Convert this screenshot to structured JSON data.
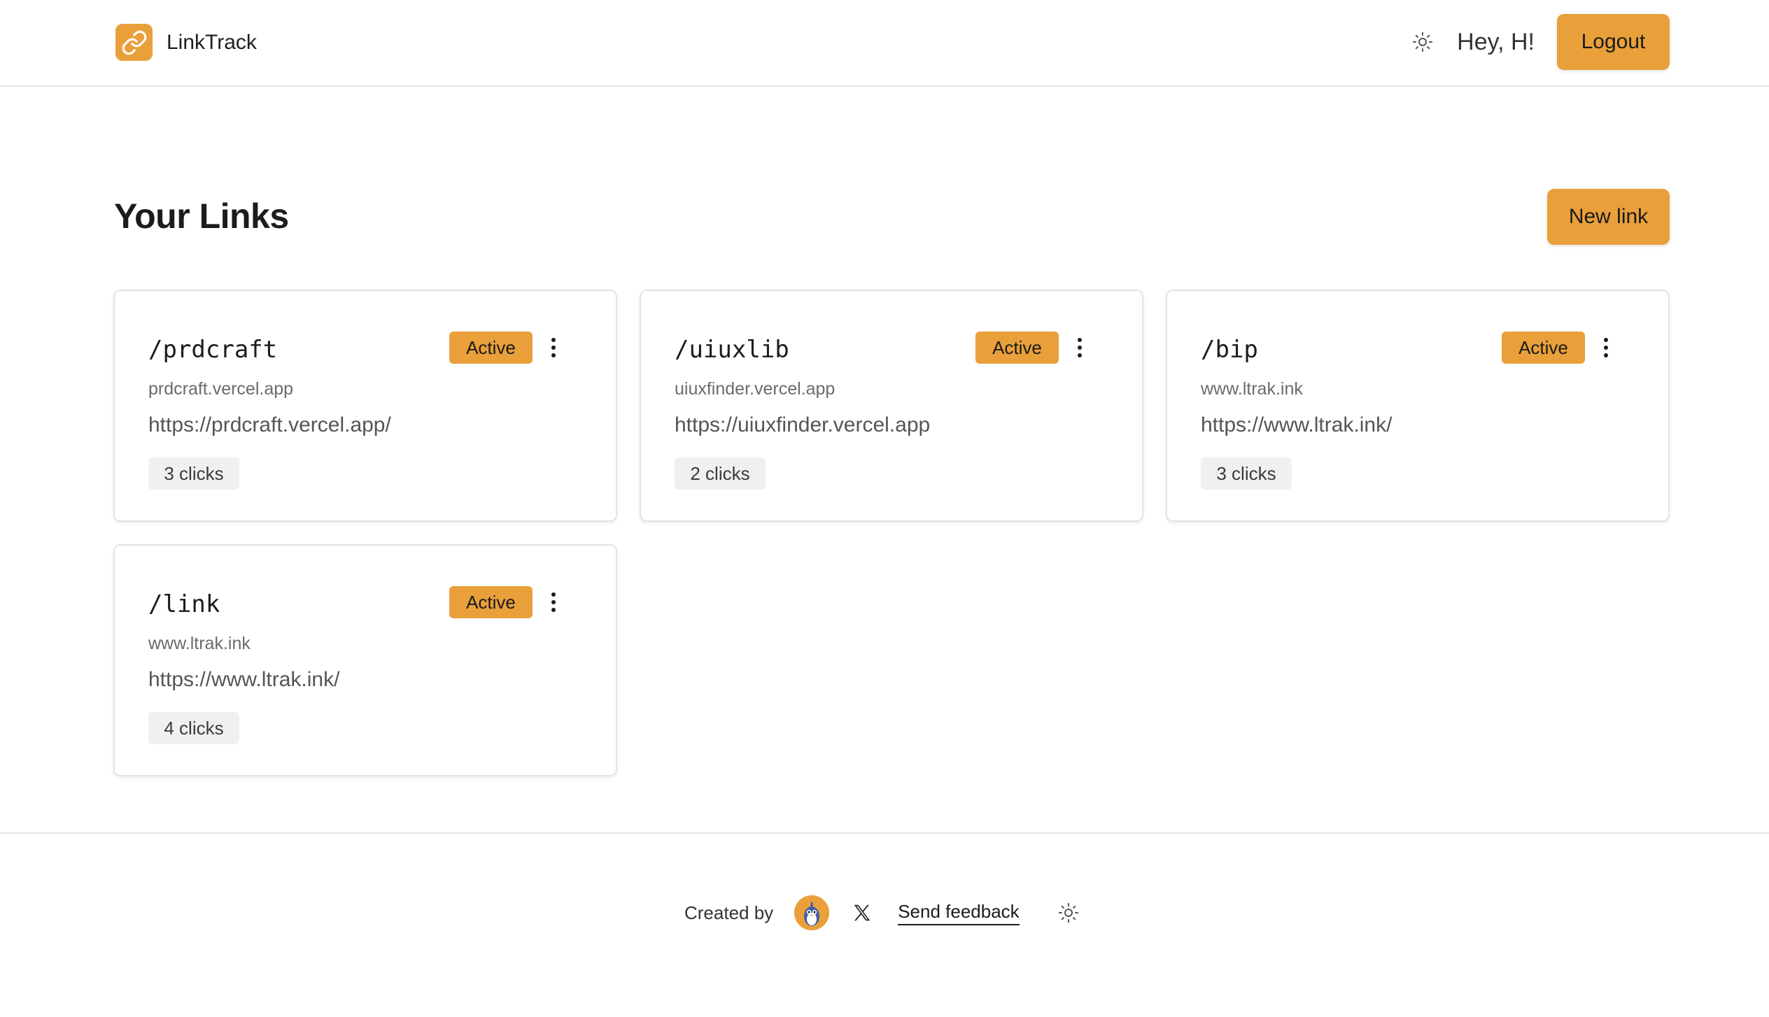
{
  "app": {
    "name": "LinkTrack",
    "accent_color": "#e9a03a"
  },
  "header": {
    "theme_icon": "sun-icon",
    "greeting": "Hey, H!",
    "logout_label": "Logout"
  },
  "main": {
    "title": "Your Links",
    "new_link_label": "New link",
    "links": [
      {
        "slug": "/prdcraft",
        "status": "Active",
        "domain": "prdcraft.vercel.app",
        "url": "https://prdcraft.vercel.app/",
        "clicks": "3 clicks"
      },
      {
        "slug": "/uiuxlib",
        "status": "Active",
        "domain": "uiuxfinder.vercel.app",
        "url": "https://uiuxfinder.vercel.app",
        "clicks": "2 clicks"
      },
      {
        "slug": "/bip",
        "status": "Active",
        "domain": "www.ltrak.ink",
        "url": "https://www.ltrak.ink/",
        "clicks": "3 clicks"
      },
      {
        "slug": "/link",
        "status": "Active",
        "domain": "www.ltrak.ink",
        "url": "https://www.ltrak.ink/",
        "clicks": "4 clicks"
      }
    ]
  },
  "footer": {
    "created_by": "Created by",
    "x_icon": "x-icon",
    "feedback_label": "Send feedback",
    "theme_icon": "sun-icon"
  }
}
